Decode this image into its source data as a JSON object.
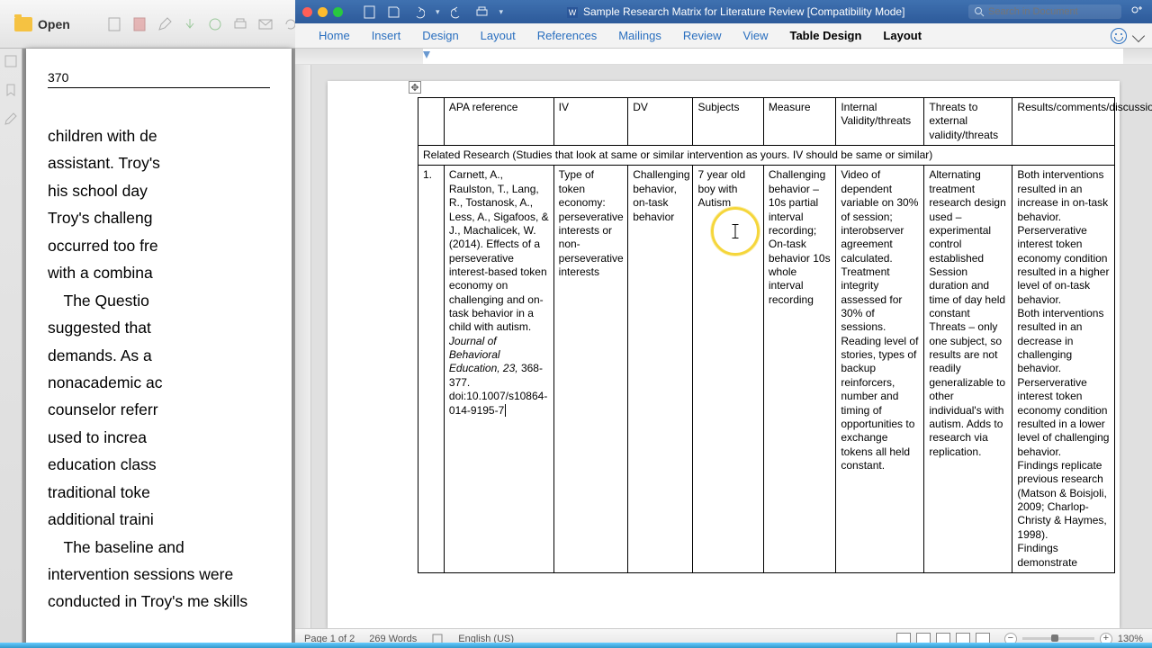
{
  "preview": {
    "open_label": "Open",
    "page_number": "370",
    "body": "children with de\nassistant.  Troy's\nhis  school  day\nTroy's  challeng\noccurred too fre\nwith a combina\n The  Questio\nsuggested   that\ndemands.   As   a\nnonacademic  ac\ncounselor referr\nused  to  increa\neducation  class\ntraditional  toke\nadditional  traini\n The  baseline  and  intervention  sessions  were  conducted  in  Troy's  me  skills"
  },
  "word": {
    "doc_title": "Sample Research Matrix for Literature Review  [Compatibility Mode]",
    "search_placeholder": "Search in Document",
    "tabs": [
      "Home",
      "Insert",
      "Design",
      "Layout",
      "References",
      "Mailings",
      "Review",
      "View",
      "Table Design",
      "Layout"
    ],
    "active_tabs": [
      "Table Design",
      "Layout_last"
    ],
    "table": {
      "headers": {
        "num": "",
        "apa": "APA reference",
        "iv": "IV",
        "dv": "DV",
        "subj": "Subjects",
        "meas": "Measure",
        "int": "Internal Validity/threats",
        "thr": "Threats to external validity/threats",
        "res": "Results/comments/discussion"
      },
      "section": "Related  Research (Studies that look at same or similar intervention as yours. IV should be same or similar)",
      "row1": {
        "num": "1.",
        "apa_plain": "Carnett, A., Raulston, T., Lang, R., Tostanosk, A., Less, A., Sigafoos, & J., Machalicek, W. (2014). Effects of a perseverative interest-based token economy on challenging and on-task behavior in a child with autism.",
        "apa_ital": "Journal of Behavioral Education, 23,",
        "apa_tail": " 368-377. doi:10.1007/s10864-014-9195-7",
        "iv": "Type of token economy: perseverative interests or non-perseverative interests",
        "dv": "Challenging behavior, on-task behavior",
        "subj": "7 year old boy with Autism",
        "meas": "Challenging behavior – 10s partial interval recording; On-task behavior 10s whole interval recording",
        "int": "Video of dependent variable on 30% of session; interobserver agreement calculated. Treatment integrity assessed for 30% of sessions. Reading level of stories, types of backup reinforcers, number and timing of opportunities to exchange tokens all held constant.",
        "thr": "Alternating treatment research design used – experimental control established Session duration and time of day held constant Threats – only one subject, so results are not readily generalizable to other individual's with autism. Adds to research via replication.",
        "res": "Both interventions resulted in an increase in on-task behavior. Perserverative interest token economy condition resulted in a higher level of on-task behavior.\nBoth interventions resulted in an decrease in challenging behavior. Perserverative interest token economy condition resulted in a lower level of challenging behavior.\nFindings replicate previous research (Matson & Boisjoli, 2009; Charlop-Christy & Haymes, 1998).\nFindings demonstrate"
      }
    },
    "status": {
      "page": "Page 1 of 2",
      "words": "269 Words",
      "lang": "English (US)",
      "zoom": "130%"
    }
  }
}
